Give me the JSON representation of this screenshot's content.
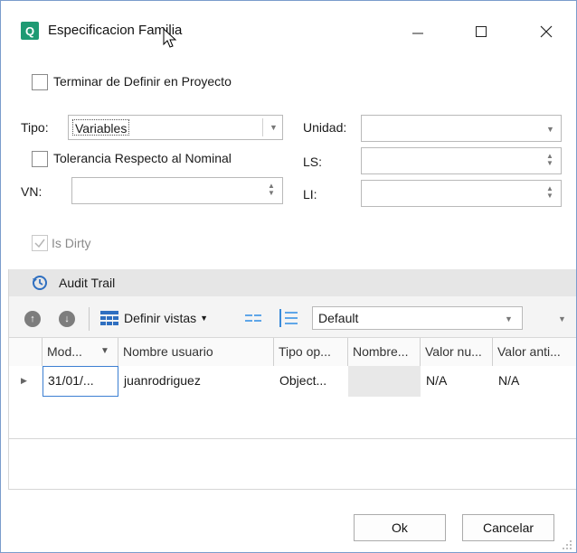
{
  "window": {
    "title": "Especificacion Familia",
    "icon": "app-logo-icon"
  },
  "form": {
    "terminar_label": "Terminar de Definir en Proyecto",
    "tipo_label": "Tipo:",
    "tipo_value": "Variables",
    "tolerancia_label": "Tolerancia Respecto al Nominal",
    "vn_label": "VN:",
    "vn_value": "",
    "unidad_label": "Unidad:",
    "unidad_value": "",
    "ls_label": "LS:",
    "ls_value": "",
    "li_label": "LI:",
    "li_value": "",
    "is_dirty_label": "Is Dirty",
    "is_dirty_checked": true
  },
  "audit": {
    "section_title": "Audit Trail",
    "definir_vistas_label": "Definir vistas",
    "view_select_value": "Default",
    "columns": [
      "Mod...",
      "Nombre usuario",
      "Tipo op...",
      "Nombre...",
      "Valor nu...",
      "Valor anti..."
    ],
    "rows": [
      [
        "31/01/...",
        "juanrodriguez",
        "Object...",
        "",
        "N/A",
        "N/A"
      ]
    ]
  },
  "buttons": {
    "ok": "Ok",
    "cancel": "Cancelar"
  },
  "colors": {
    "accent_icon": "#1f9a73",
    "selected_border": "#3c7fd2",
    "grid_icon": "#2f6fc0"
  }
}
